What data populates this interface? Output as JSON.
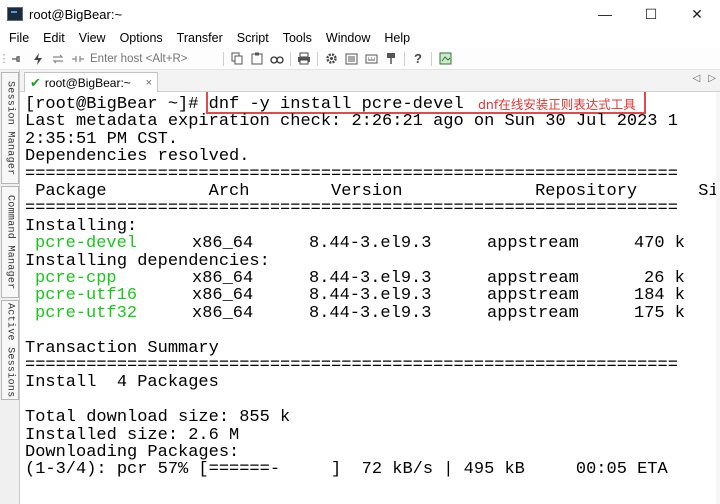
{
  "window": {
    "title": "root@BigBear:~",
    "minimize": "—",
    "maximize": "☐",
    "close": "✕"
  },
  "menu": [
    "File",
    "Edit",
    "View",
    "Options",
    "Transfer",
    "Script",
    "Tools",
    "Window",
    "Help"
  ],
  "toolbar": {
    "host_placeholder": "Enter host <Alt+R>",
    "icons": [
      "connect-icon",
      "quick-connect-icon",
      "reconnect-icon",
      "disconnect-icon",
      "copy-icon",
      "paste-icon",
      "find-icon",
      "print-icon",
      "settings-icon",
      "session-options-icon",
      "keymap-icon",
      "help-icon",
      "map-icon"
    ]
  },
  "sidebar": {
    "tabs": [
      "Session Manager",
      "Command Manager",
      "Active Sessions"
    ]
  },
  "session_tab": {
    "label": "root@BigBear:~",
    "close": "×",
    "nav_left": "◁",
    "nav_right": "▷"
  },
  "annotation": {
    "note": "dnf在线安装正则表达式工具"
  },
  "terminal": {
    "prompt": "[root@BigBear ~]# ",
    "command": "dnf -y install pcre-devel",
    "lines": [
      "Last metadata expiration check: 2:26:21 ago on Sun 30 Jul 2023 1",
      "2:35:51 PM CST.",
      "Dependencies resolved.",
      "================================================================",
      " Package          Arch        Version             Repository      Size",
      "================================================================",
      "Installing:",
      "Installing dependencies:",
      "",
      "Transaction Summary",
      "================================================================",
      "Install  4 Packages",
      "",
      "Total download size: 855 k",
      "Installed size: 2.6 M",
      "Downloading Packages:",
      "(1-3/4): pcr 57% [======-     ]  72 kB/s | 495 kB     00:05 ETA"
    ],
    "packages": [
      {
        "name": "pcre-devel",
        "arch": "x86_64",
        "version": "8.44-3.el9.3",
        "repo": "appstream",
        "size": "470 k"
      },
      {
        "name": "pcre-cpp",
        "arch": "x86_64",
        "version": "8.44-3.el9.3",
        "repo": "appstream",
        "size": "26 k"
      },
      {
        "name": "pcre-utf16",
        "arch": "x86_64",
        "version": "8.44-3.el9.3",
        "repo": "appstream",
        "size": "184 k"
      },
      {
        "name": "pcre-utf32",
        "arch": "x86_64",
        "version": "8.44-3.el9.3",
        "repo": "appstream",
        "size": "175 k"
      }
    ]
  },
  "colors": {
    "package_green": "#18c818",
    "highlight_red": "#e24a4a",
    "note_red": "#e0332f"
  }
}
